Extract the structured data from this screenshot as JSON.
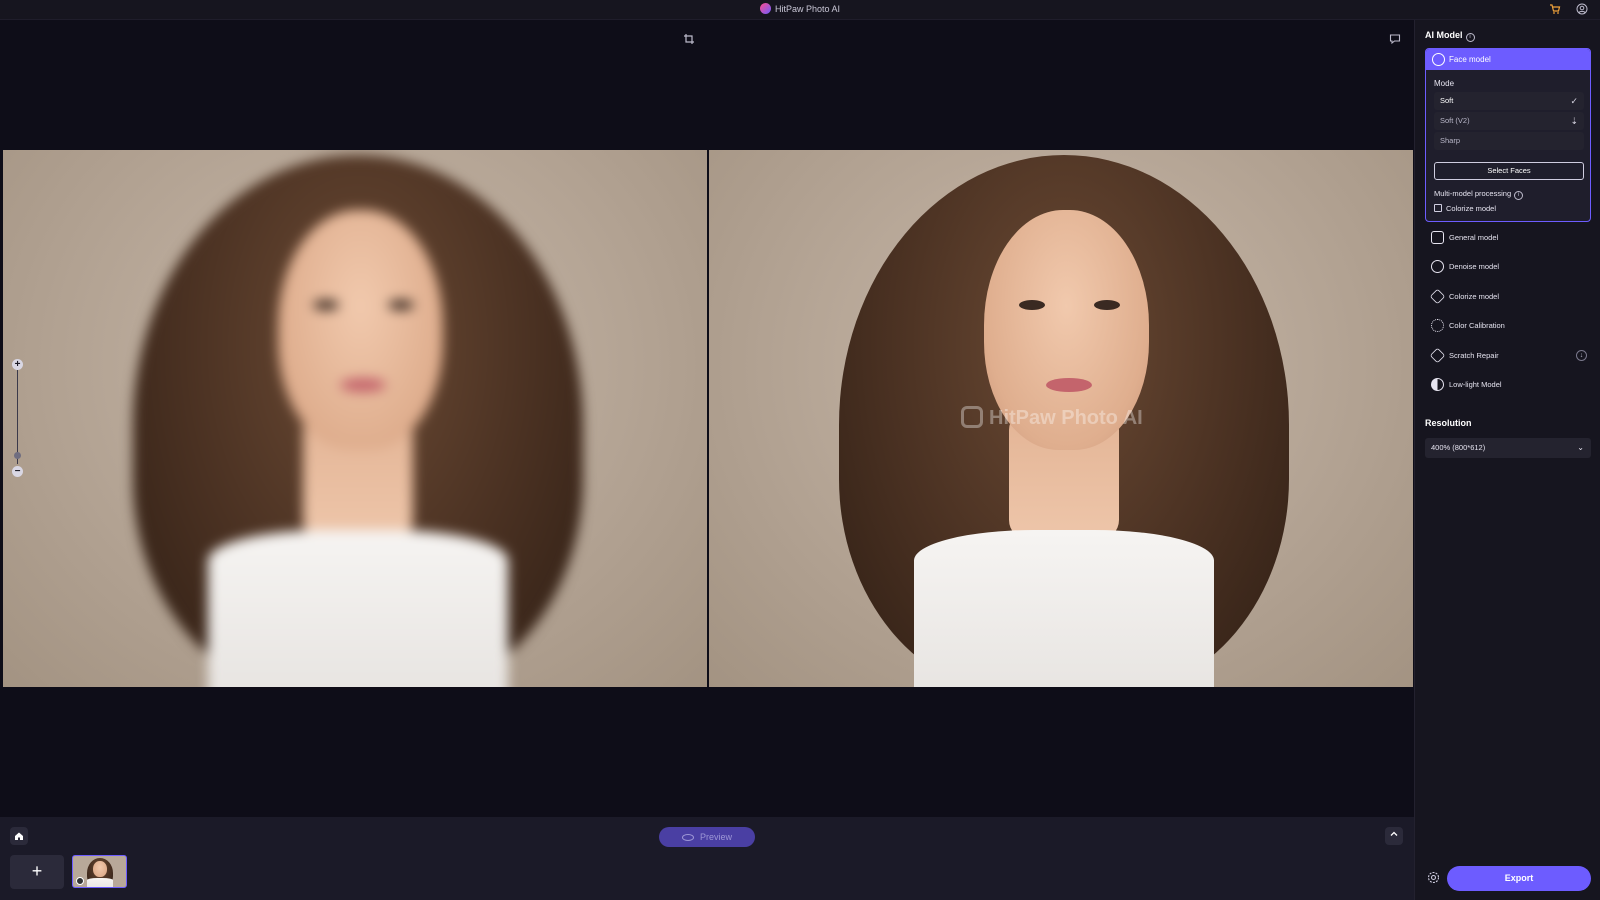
{
  "app": {
    "title": "HitPaw Photo AI"
  },
  "titlebar": {
    "cart_icon": "cart-icon",
    "account_icon": "user-icon"
  },
  "canvas": {
    "crop_icon": "crop-icon",
    "feedback_icon": "comment-icon",
    "watermark": "HitPaw Photo AI",
    "zoom_in": "+",
    "zoom_out": "−"
  },
  "sidebar": {
    "ai_model_title": "AI Model",
    "face_model": {
      "label": "Face model",
      "mode_label": "Mode",
      "modes": [
        {
          "label": "Soft",
          "state": "selected"
        },
        {
          "label": "Soft (V2)",
          "state": "download"
        },
        {
          "label": "Sharp",
          "state": ""
        }
      ],
      "select_faces": "Select Faces",
      "multi_model": "Multi-model processing",
      "colorize_check": "Colorize model"
    },
    "models": [
      {
        "label": "General model",
        "icon": "general-model-icon"
      },
      {
        "label": "Denoise model",
        "icon": "denoise-icon"
      },
      {
        "label": "Colorize model",
        "icon": "colorize-icon"
      },
      {
        "label": "Color Calibration",
        "icon": "sun-icon"
      },
      {
        "label": "Scratch Repair",
        "icon": "scratch-icon",
        "download": true
      },
      {
        "label": "Low-light Model",
        "icon": "contrast-icon"
      }
    ],
    "resolution_title": "Resolution",
    "resolution_value": "400% (800*612)",
    "export": "Export"
  },
  "bottombar": {
    "preview": "Preview",
    "add": "+"
  },
  "colors": {
    "accent": "#6d5cff",
    "background": "#0e0d18",
    "panel": "#16151f"
  }
}
